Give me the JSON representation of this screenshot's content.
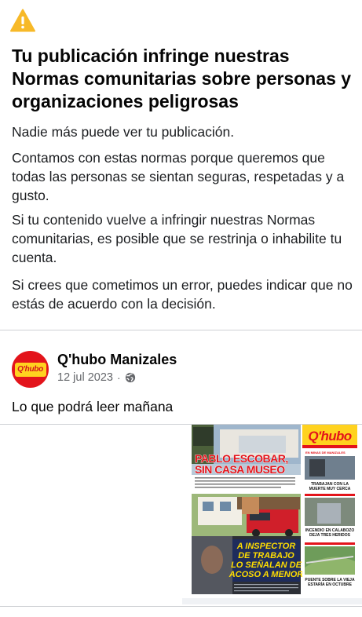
{
  "notice": {
    "icon": "warning-icon",
    "title": "Tu publicación infringe nuestras Normas comunitarias sobre personas y organizaciones peligrosas",
    "paragraphs": [
      "Nadie más puede ver tu publicación.",
      "Contamos con estas normas porque queremos que todas las personas se sientan seguras, respetadas y a gusto.",
      "Si tu contenido vuelve a infringir nuestras Normas comunitarias, es posible que se restrinja o inhabilite tu cuenta.",
      "Si crees que cometimos un error, puedes indicar que no estás de acuerdo con la decisión."
    ]
  },
  "post": {
    "page_name": "Q'hubo Manizales",
    "avatar_text": "Q'hubo",
    "date": "12 jul 2023",
    "separator": "·",
    "audience_icon": "globe-icon",
    "caption": "Lo que podrá leer mañana"
  },
  "newspaper": {
    "masthead": "Q'hubo",
    "headline_main": "PABLO ESCOBAR, SIN CASA MUSEO",
    "headline_inspector": "A INSPECTOR DE TRABAJO LO SEÑALAN DE ACOSO A MENOR",
    "side_top_label": "EN MINAS DE MANIZALES",
    "side1": "TRABAJAN CON LA MUERTE MUY CERCA",
    "side2": "INCENDIO EN CALABOZO DEJA TRES HERIDOS",
    "side3": "PUENTE SOBRE LA VIEJA ESTARÍA EN OCTUBRE"
  },
  "colors": {
    "warning": "#f7b928",
    "text_primary": "#050505",
    "text_secondary": "#65676b",
    "divider": "#ced0d4",
    "brand_red": "#e3141b",
    "brand_yellow": "#ffd21f"
  }
}
